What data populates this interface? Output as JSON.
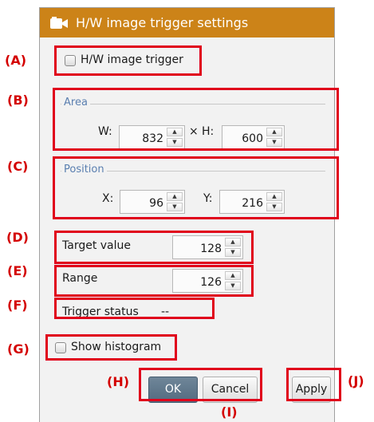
{
  "dialog": {
    "title": "H/W image trigger settings",
    "title_icon": "camera-icon",
    "accent_color": "#cc8318"
  },
  "callouts": {
    "a": "(A)",
    "b": "(B)",
    "c": "(C)",
    "d": "(D)",
    "e": "(E)",
    "f": "(F)",
    "g": "(G)",
    "h": "(H)",
    "i": "(I)",
    "j": "(J)"
  },
  "hw_trigger": {
    "label": "H/W image trigger",
    "checked": false
  },
  "area": {
    "group_label": "Area",
    "w_label": "W:",
    "w_value": "832",
    "separator": "×",
    "h_label": "H:",
    "h_value": "600"
  },
  "position": {
    "group_label": "Position",
    "x_label": "X:",
    "x_value": "96",
    "y_label": "Y:",
    "y_value": "216"
  },
  "target": {
    "label": "Target value",
    "value": "128"
  },
  "range": {
    "label": "Range",
    "value": "126"
  },
  "trigger_status": {
    "label": "Trigger status",
    "value": "--"
  },
  "histogram": {
    "label": "Show histogram",
    "checked": false
  },
  "buttons": {
    "ok": "OK",
    "cancel": "Cancel",
    "apply": "Apply"
  },
  "annotation_color": "#e0001b"
}
